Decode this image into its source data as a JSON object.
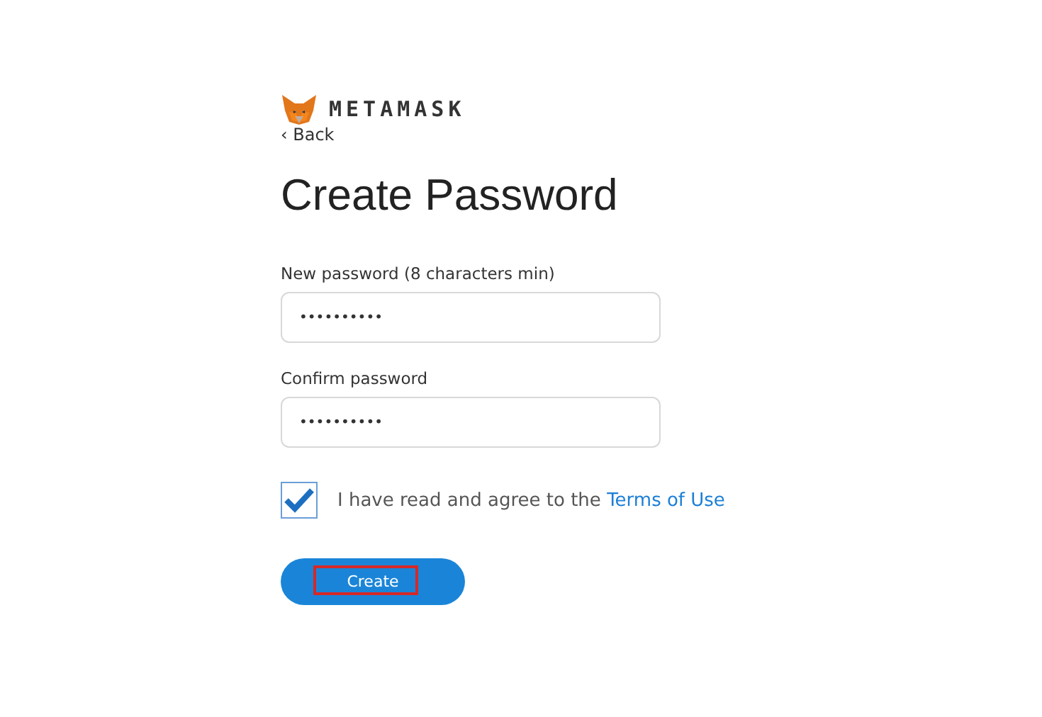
{
  "brand": {
    "name": "METAMASK"
  },
  "back_link": "‹ Back",
  "title": "Create Password",
  "fields": [
    {
      "label": "New password (8 characters min)",
      "value": "••••••••••"
    },
    {
      "label": "Confirm password",
      "value": "••••••••••"
    }
  ],
  "terms": {
    "checked": true,
    "text": "I have read and agree to the",
    "link": "Terms of Use"
  },
  "create_button": {
    "label": "Create",
    "highlighted": true
  }
}
